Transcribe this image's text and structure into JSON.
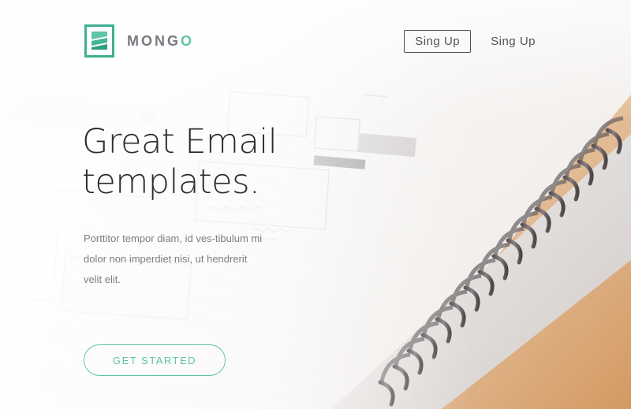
{
  "brand": {
    "name_main": "MONG",
    "name_accent": "O",
    "logo_icon": "mongo-logo-icon",
    "accent_color": "#5ec3a7"
  },
  "nav": {
    "items": [
      {
        "label": "Sing Up",
        "style": "outlined"
      },
      {
        "label": "Sing Up",
        "style": "plain"
      }
    ]
  },
  "hero": {
    "headline_line1": "Great Email",
    "headline_line2": "templates.",
    "description": "Porttitor tempor diam, id ves-tibulum mi dolor non imperdiet nisi, ut hendrerit velit elit.",
    "cta_label": "GET STARTED"
  }
}
